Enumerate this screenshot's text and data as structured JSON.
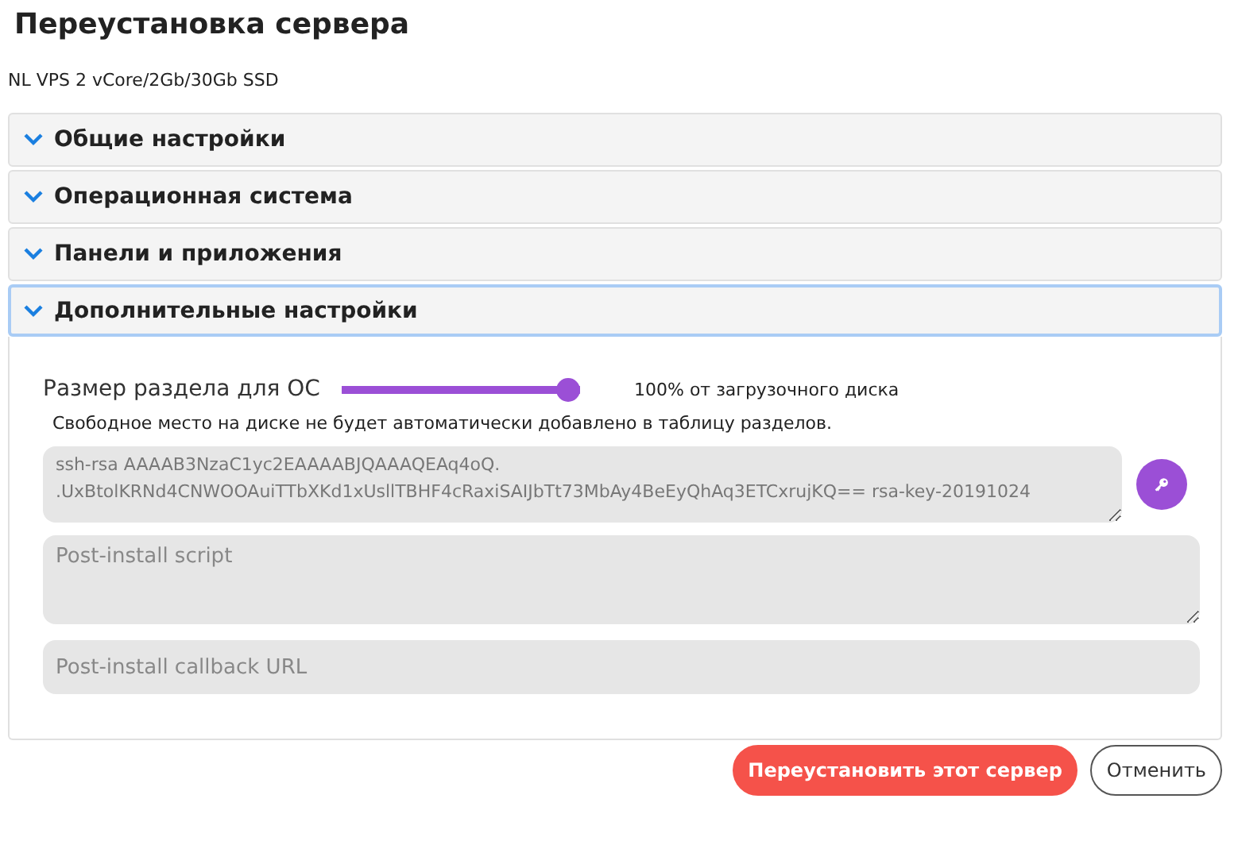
{
  "title": "Переустановка сервера",
  "subtitle": "NL VPS 2 vCore/2Gb/30Gb SSD",
  "sections": [
    {
      "label": "Общие настройки",
      "expanded": false
    },
    {
      "label": "Операционная система",
      "expanded": false
    },
    {
      "label": "Панели и приложения",
      "expanded": false
    },
    {
      "label": "Дополнительные настройки",
      "expanded": true
    }
  ],
  "partition": {
    "label": "Размер раздела для ОС",
    "level": 1,
    "reading": "100% от загрузочного диска",
    "note": "Свободное место на диске не будет автоматически добавлено в таблицу разделов."
  },
  "ssh_key": {
    "value": "ssh-rsa AAAAB3NzaC1yc2EAAAABJQAAAQEAq4oQ.\n.UxBtolKRNd4CNWOOAuiTTbXKd1xUsllTBHF4cRaxiSAIJbTt73MbAy4BeEyQhAq3ETCxrujKQ== rsa-key-20191024"
  },
  "post_install_script": {
    "placeholder": "Post-install script"
  },
  "callback_url": {
    "placeholder": "Post-install callback URL"
  },
  "buttons": [
    {
      "label": "Переустановить этот сервер",
      "kind": "primary"
    },
    {
      "label": "Отменить",
      "kind": "secondary"
    }
  ]
}
